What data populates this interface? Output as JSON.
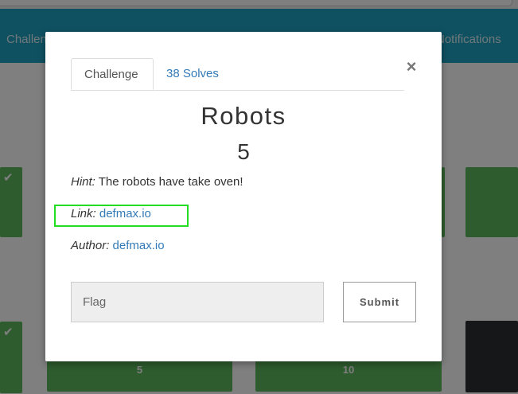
{
  "nav": {
    "challenges_label": "Challenges",
    "notifications_label": "Notifications"
  },
  "cards": {
    "row2_left_value": "5",
    "row2_mid_value": "10"
  },
  "modal": {
    "tabs": [
      {
        "label": "Challenge"
      },
      {
        "label": "38 Solves"
      }
    ],
    "close_label": "×",
    "title": "Robots",
    "value": "5",
    "hint_label": "Hint:",
    "hint_text": "The robots have take oven!",
    "link_label": "Link:",
    "link_text": "defmax.io",
    "author_label": "Author:",
    "author_text": "defmax.io",
    "flag_placeholder": "Flag",
    "submit_label": "Submit"
  },
  "colors": {
    "navbar": "#1fa3c2",
    "solved_card": "#5cb85c",
    "link": "#337ab7",
    "highlight": "#22dd22"
  }
}
